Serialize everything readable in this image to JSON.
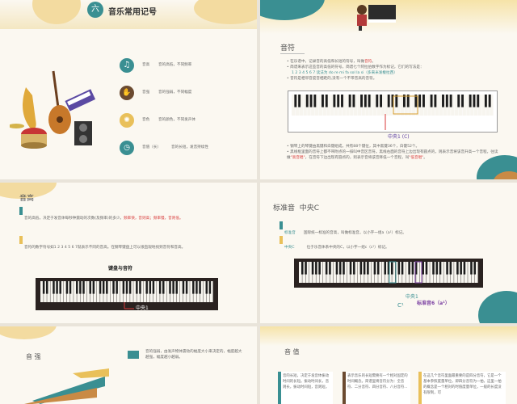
{
  "slide1": {
    "number": "六",
    "title": "音乐常用记号",
    "items": [
      {
        "icon": "music-icon",
        "label": "音高",
        "desc": "音的高低，不同频率"
      },
      {
        "icon": "hand-icon",
        "label": "音强",
        "desc": "音的强弱，不同幅度"
      },
      {
        "icon": "lightbulb-icon",
        "label": "音色",
        "desc": "音的颜色，不同发声体"
      },
      {
        "icon": "clock-icon",
        "label": "音值（长）",
        "desc": "音的长短，发音持续性"
      }
    ]
  },
  "slide2": {
    "title": "音符",
    "p1_a": "在乐谱中，记录音的高低和长短的符号，叫做",
    "p1_b": "音符",
    "p1_c": "。",
    "p2": "简谱来表示这些音的高低的符号，简谱七个阿拉伯数字作为标记，它们的写法是：",
    "p3": "1 2 3 4 5 6 7 读法为 do re mi fa sol la si（多来米发梭拉西）",
    "p4": "音符是相邻音度音相距的,没有一个不带音高的音符。",
    "b1": "钢琴上的琴键由黑键和白键组成，共有88个键位，其中黑键36个，白键52个。",
    "b2_a": "黑线框里面的音符上都不带附点的一排叫中音区音符。黑线右面的音符上边出现有圆点的，则表示音将该音升高一个音程，往读做",
    "b2_b": "\"高音唱\"",
    "b2_c": "，在音符下边出现有圆点的，则表示音将该音降低一个音程，叫",
    "b2_d": "\"低音唱\"",
    "b2_e": "。",
    "center_label": "中央1 (C)"
  },
  "slide3": {
    "title": "音高",
    "item1_a": "音的高低，决定于发音体每秒钟震动的次数(及频率)的多少。",
    "item1_b": "频率快，音则高；频率慢，音则低。",
    "item2": "音符的数字符号如1 2 3 4 5 6 7就表示不同的音高。在钢琴键盘上可以很直观地找到音符和音高。",
    "subtitle": "键盘与音符",
    "center_label": "中央1"
  },
  "slide4": {
    "title": "标准音",
    "title2": "中央C",
    "item1_label": "标准音",
    "item1_text": "国际统一标准的音高，叫做标准音。以小字一组a（a¹）标记。",
    "item2_label": "中央C",
    "item2_text": "位于乐音体系中央的C，以小字一组c（c¹）标记。",
    "c_label": "C¹",
    "center_label": "中央1",
    "std_label": "标准音6（a¹）"
  },
  "slide5": {
    "title": "音 强",
    "text": "音的强弱，由发声物体震动的幅度大小来决定的，幅度越大越强，幅度越小越弱。"
  },
  "slide6": {
    "title": "音 值",
    "col1": "音的长短，决定于发音体振动时间的长短。振动时间长，音则长，振动时间短，音则短。",
    "col2": "表示音乐的长短需要有一个相对固定的时间概念。简谱里将音符分为：全音符、二分音符、四分音符、八分音符...",
    "col3": "在这几个音符里面最重要的是四分音符，它是一个基本参照度量单位，即四分音符为一拍，这里一拍的概念是一个相对的时值度量单位，一般的长度没有限制，可"
  },
  "colors": {
    "teal": "#3a8f92",
    "brown": "#c98a45",
    "yellow": "#f6e3a8",
    "red": "#d83a3a",
    "purple": "#7a3ea1"
  }
}
